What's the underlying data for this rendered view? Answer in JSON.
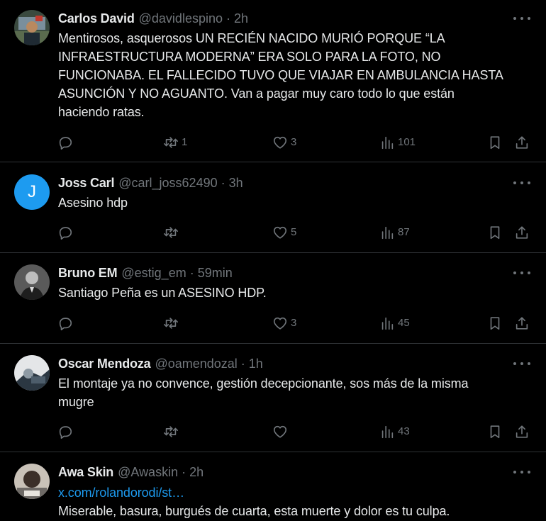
{
  "tweets": [
    {
      "name": "Carlos David",
      "handle": "@davidlespino",
      "separator": "·",
      "time": "2h",
      "text_lines": [
        "Mentirosos, asquerosos UN RECIÉN NACIDO MURIÓ PORQUE “LA",
        "INFRAESTRUCTURA MODERNA” ERA SOLO PARA LA FOTO, NO",
        "FUNCIONABA. EL FALLECIDO TUVO QUE VIAJAR EN AMBULANCIA HASTA",
        "ASUNCIÓN Y NO AGUANTO. Van a pagar muy caro todo lo que están",
        "haciendo ratas."
      ],
      "stats": {
        "replies": "",
        "retweets": "1",
        "likes": "3",
        "views": "101"
      }
    },
    {
      "name": "Joss Carl",
      "handle": "@carl_joss62490",
      "separator": "·",
      "time": "3h",
      "avatar_letter": "J",
      "text_lines": [
        "Asesino hdp"
      ],
      "stats": {
        "replies": "",
        "retweets": "",
        "likes": "5",
        "views": "87"
      }
    },
    {
      "name": "Bruno EM",
      "handle": "@estig_em",
      "separator": "·",
      "time": "59min",
      "text_lines": [
        "Santiago Peña es un ASESINO HDP."
      ],
      "stats": {
        "replies": "",
        "retweets": "",
        "likes": "3",
        "views": "45"
      }
    },
    {
      "name": "Oscar Mendoza",
      "handle": "@oamendozal",
      "separator": "·",
      "time": "1h",
      "text_lines": [
        "El montaje ya no convence, gestión decepcionante, sos más de la misma",
        "mugre"
      ],
      "stats": {
        "replies": "",
        "retweets": "",
        "likes": "",
        "views": "43"
      }
    },
    {
      "name": "Awa Skin",
      "handle": "@Awaskin",
      "separator": "·",
      "time": "2h",
      "link": "x.com/rolandorodi/st…",
      "text_lines": [
        "Miserable, basura, burgués de cuarta, esta muerte y dolor es tu culpa."
      ]
    }
  ],
  "colors": {
    "background": "#000000",
    "text": "#e7e9ea",
    "secondary": "#71767b",
    "divider": "#2f3336",
    "accent": "#1d9bf0"
  },
  "icons": [
    "reply-icon",
    "retweet-icon",
    "like-icon",
    "views-icon",
    "bookmark-icon",
    "share-icon",
    "more-icon"
  ]
}
